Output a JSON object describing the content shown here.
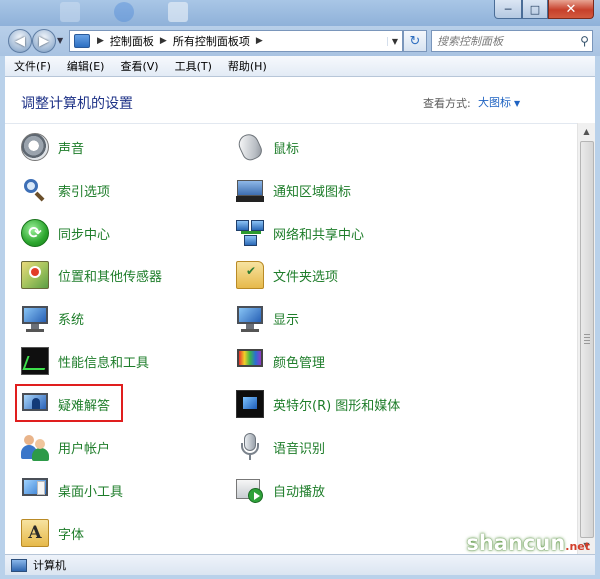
{
  "window": {
    "controls": {
      "minimize": "─",
      "maximize": "□",
      "close": "✕"
    }
  },
  "address_bar": {
    "back_icon": "back-arrow-icon",
    "forward_icon": "forward-arrow-icon",
    "breadcrumbs": [
      "控制面板",
      "所有控制面板项"
    ],
    "search_placeholder": "搜索控制面板"
  },
  "menu": [
    "文件(F)",
    "编辑(E)",
    "查看(V)",
    "工具(T)",
    "帮助(H)"
  ],
  "content": {
    "title": "调整计算机的设置",
    "view_by_label": "查看方式:",
    "view_by_value": "大图标",
    "items_left": [
      {
        "label": "声音",
        "icon": "speaker-icon"
      },
      {
        "label": "索引选项",
        "icon": "index-search-icon"
      },
      {
        "label": "同步中心",
        "icon": "sync-center-icon"
      },
      {
        "label": "位置和其他传感器",
        "icon": "location-sensor-icon"
      },
      {
        "label": "系统",
        "icon": "system-monitor-icon"
      },
      {
        "label": "性能信息和工具",
        "icon": "performance-icon"
      },
      {
        "label": "疑难解答",
        "icon": "troubleshooting-icon",
        "highlighted": true
      },
      {
        "label": "用户帐户",
        "icon": "user-accounts-icon"
      },
      {
        "label": "桌面小工具",
        "icon": "desktop-gadgets-icon"
      },
      {
        "label": "字体",
        "icon": "fonts-folder-icon"
      }
    ],
    "items_right": [
      {
        "label": "鼠标",
        "icon": "mouse-icon"
      },
      {
        "label": "通知区域图标",
        "icon": "notification-tray-icon"
      },
      {
        "label": "网络和共享中心",
        "icon": "network-icon"
      },
      {
        "label": "文件夹选项",
        "icon": "folder-options-icon"
      },
      {
        "label": "显示",
        "icon": "display-monitor-icon"
      },
      {
        "label": "颜色管理",
        "icon": "color-management-icon"
      },
      {
        "label": "英特尔(R) 图形和媒体",
        "icon": "intel-graphics-icon"
      },
      {
        "label": "语音识别",
        "icon": "microphone-icon"
      },
      {
        "label": "自动播放",
        "icon": "autoplay-icon"
      }
    ]
  },
  "status_bar": {
    "text": "计算机"
  },
  "watermark": {
    "main": "shancun",
    "suffix": ".net"
  }
}
